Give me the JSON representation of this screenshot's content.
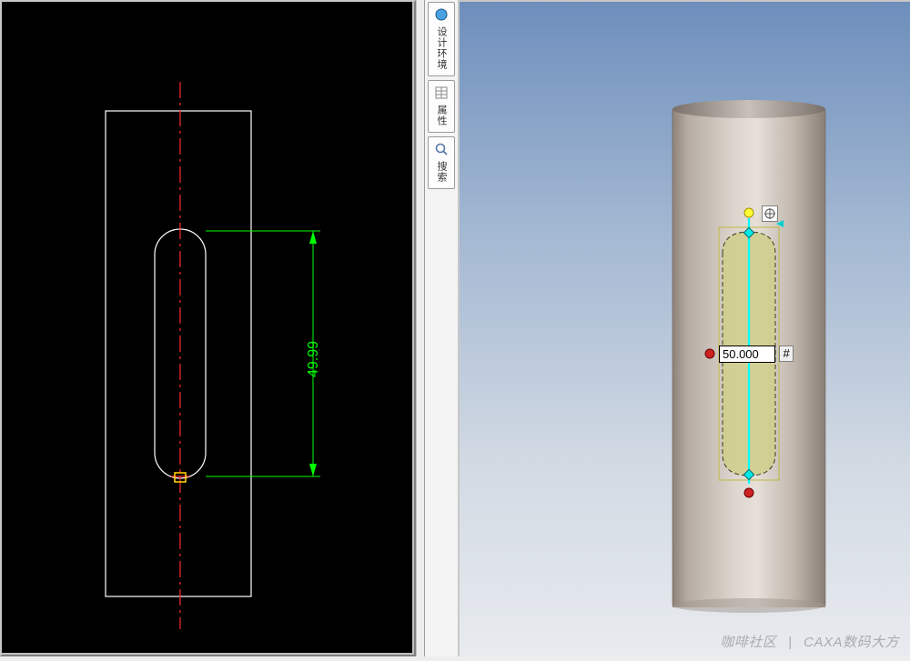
{
  "tabs": {
    "design_env": "设计环境",
    "properties": "属性",
    "search": "搜索"
  },
  "view2d": {
    "dimension_value": "49.99",
    "centerline_color": "#ff2a2a",
    "outline_color": "#ffffff",
    "dimension_color": "#00ff00",
    "marker_color": "#ffcc00"
  },
  "view3d": {
    "dimension_input": "50.000",
    "hash_label": "#",
    "sketch_fill": "#cfce89",
    "sketch_stroke": "#3a3a1a",
    "axis_color": "#00ffff",
    "handle_yellow": "#ffff33",
    "handle_cyan": "#00e8e8",
    "handle_red": "#cc2222"
  },
  "watermark": {
    "left": "咖啡社区",
    "sep": "|",
    "right": "CAXA数码大方"
  }
}
